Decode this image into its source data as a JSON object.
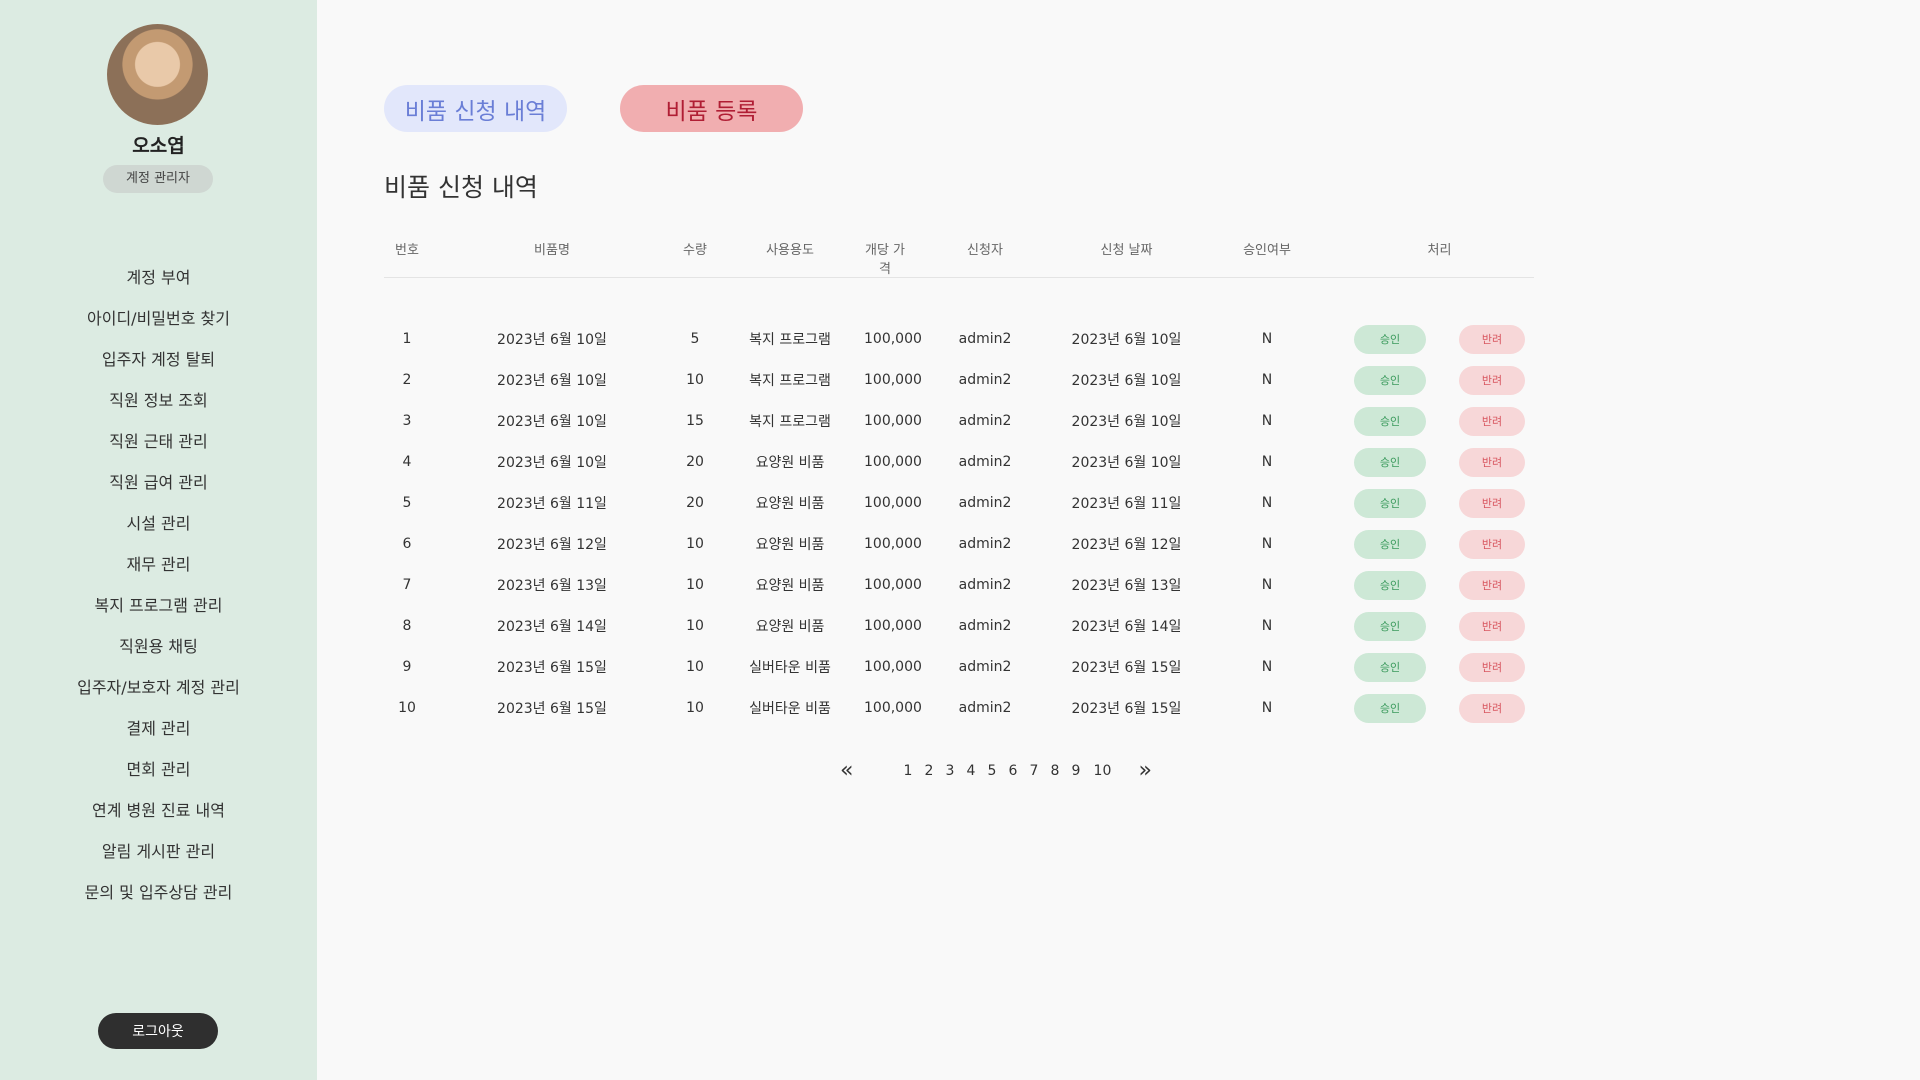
{
  "user": {
    "name": "오소엽",
    "role": "계정 관리자"
  },
  "sidebar": {
    "items": [
      {
        "label": "계정 부여"
      },
      {
        "label": "아이디/비밀번호 찾기"
      },
      {
        "label": "입주자 계정 탈퇴"
      },
      {
        "label": "직원 정보 조회"
      },
      {
        "label": "직원 근태 관리"
      },
      {
        "label": "직원 급여 관리"
      },
      {
        "label": "시설 관리"
      },
      {
        "label": "재무 관리"
      },
      {
        "label": "복지 프로그램 관리"
      },
      {
        "label": "직원용 채팅"
      },
      {
        "label": "입주자/보호자 계정 관리"
      },
      {
        "label": "결제 관리"
      },
      {
        "label": "면회 관리"
      },
      {
        "label": "연계 병원 진료 내역"
      },
      {
        "label": "알림 게시판 관리"
      },
      {
        "label": "문의 및 입주상담 관리"
      }
    ],
    "logout": "로그아웃"
  },
  "tabs": {
    "list": "비품 신청 내역",
    "register": "비품 등록"
  },
  "main": {
    "title": "비품 신청 내역"
  },
  "table": {
    "headers": [
      "번호",
      "비품명",
      "수량",
      "사용용도",
      "개당 가격",
      "신청자",
      "신청 날짜",
      "승인여부",
      "처리"
    ],
    "approve_label": "승인",
    "reject_label": "반려",
    "rows": [
      {
        "no": "1",
        "name": "2023년 6월 10일",
        "qty": "5",
        "purpose": "복지 프로그램",
        "price": "100,000",
        "applicant": "admin2",
        "date": "2023년 6월 10일",
        "approved": "N"
      },
      {
        "no": "2",
        "name": "2023년 6월 10일",
        "qty": "10",
        "purpose": "복지 프로그램",
        "price": "100,000",
        "applicant": "admin2",
        "date": "2023년 6월 10일",
        "approved": "N"
      },
      {
        "no": "3",
        "name": "2023년 6월 10일",
        "qty": "15",
        "purpose": "복지 프로그램",
        "price": "100,000",
        "applicant": "admin2",
        "date": "2023년 6월 10일",
        "approved": "N"
      },
      {
        "no": "4",
        "name": "2023년 6월 10일",
        "qty": "20",
        "purpose": "요양원 비품",
        "price": "100,000",
        "applicant": "admin2",
        "date": "2023년 6월 10일",
        "approved": "N"
      },
      {
        "no": "5",
        "name": "2023년 6월 11일",
        "qty": "20",
        "purpose": "요양원 비품",
        "price": "100,000",
        "applicant": "admin2",
        "date": "2023년 6월 11일",
        "approved": "N"
      },
      {
        "no": "6",
        "name": "2023년 6월 12일",
        "qty": "10",
        "purpose": "요양원 비품",
        "price": "100,000",
        "applicant": "admin2",
        "date": "2023년 6월 12일",
        "approved": "N"
      },
      {
        "no": "7",
        "name": "2023년 6월 13일",
        "qty": "10",
        "purpose": "요양원 비품",
        "price": "100,000",
        "applicant": "admin2",
        "date": "2023년 6월 13일",
        "approved": "N"
      },
      {
        "no": "8",
        "name": "2023년 6월 14일",
        "qty": "10",
        "purpose": "요양원 비품",
        "price": "100,000",
        "applicant": "admin2",
        "date": "2023년 6월 14일",
        "approved": "N"
      },
      {
        "no": "9",
        "name": "2023년 6월 15일",
        "qty": "10",
        "purpose": "실버타운 비품",
        "price": "100,000",
        "applicant": "admin2",
        "date": "2023년 6월 15일",
        "approved": "N"
      },
      {
        "no": "10",
        "name": "2023년 6월 15일",
        "qty": "10",
        "purpose": "실버타운 비품",
        "price": "100,000",
        "applicant": "admin2",
        "date": "2023년 6월 15일",
        "approved": "N"
      }
    ]
  },
  "pagination": {
    "prev_icon": "«",
    "next_icon": "»",
    "pages": [
      "1",
      "2",
      "3",
      "4",
      "5",
      "6",
      "7",
      "8",
      "9",
      "10"
    ]
  },
  "colors": {
    "sidebar_bg": "#dcebe2",
    "approve_bg": "#cde8d6",
    "reject_bg": "#f7d7d8",
    "register_tab_bg": "#f1aeb0",
    "list_tab_bg": "#e2e7fb"
  }
}
